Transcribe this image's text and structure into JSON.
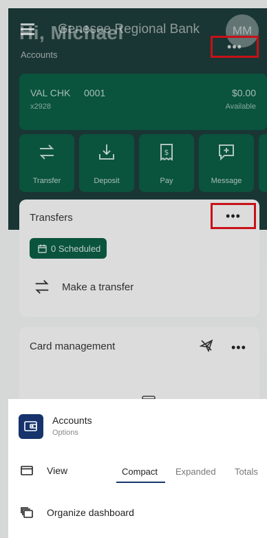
{
  "header": {
    "greeting": "Hi, Michael",
    "bank_name": "Genesee Regional Bank",
    "avatar_initials": "MM"
  },
  "accounts": {
    "section_label": "Accounts",
    "more_label": "•••",
    "card": {
      "name": "VAL CHK",
      "number": "0001",
      "masked": "x2928",
      "balance": "$0.00",
      "balance_label": "Available"
    }
  },
  "quick_actions": [
    {
      "label": "Transfer",
      "icon": "transfer-icon"
    },
    {
      "label": "Deposit",
      "icon": "deposit-icon"
    },
    {
      "label": "Pay",
      "icon": "bill-pay-icon"
    },
    {
      "label": "Message",
      "icon": "message-icon"
    }
  ],
  "transfers": {
    "title": "Transfers",
    "more_label": "•••",
    "scheduled_label": "0 Scheduled",
    "make_transfer_label": "Make a transfer"
  },
  "card_management": {
    "title": "Card management",
    "more_label": "•••"
  },
  "sheet": {
    "title": "Accounts",
    "subtitle": "Options",
    "view_label": "View",
    "view_options": [
      "Compact",
      "Expanded",
      "Totals"
    ],
    "selected_view": "Compact",
    "organize_label": "Organize dashboard"
  },
  "colors": {
    "hero_bg": "#1d3b39",
    "accent_green": "#0b5b43",
    "sheet_accent": "#16336b",
    "highlight": "#d8131a"
  }
}
